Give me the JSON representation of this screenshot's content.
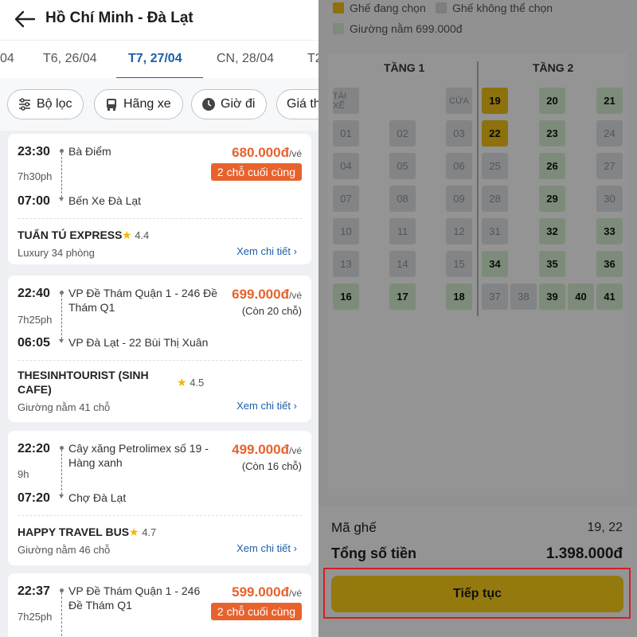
{
  "header": {
    "title": "Hồ Chí Minh - Đà Lạt",
    "back_icon": "arrow-left-icon"
  },
  "date_tabs": [
    {
      "label": "04"
    },
    {
      "label": "T6, 26/04"
    },
    {
      "label": "T7, 27/04",
      "active": true
    },
    {
      "label": "CN, 28/04"
    },
    {
      "label": "T2"
    }
  ],
  "filters": [
    {
      "label": "Bộ lọc",
      "icon": "sliders-icon"
    },
    {
      "label": "Hãng xe",
      "icon": "bus-icon"
    },
    {
      "label": "Giờ đi",
      "icon": "clock-icon"
    },
    {
      "label": "Giá th"
    }
  ],
  "trips": [
    {
      "depart": "23:30",
      "duration": "7h30ph",
      "arrive": "07:00",
      "from": "Bà Điểm",
      "to": "Bến Xe Đà Lạt",
      "price": "680.000đ",
      "per": "/vé",
      "badge": "2 chỗ cuối cùng",
      "remain": "",
      "operator": "TUẤN TÚ EXPRESS",
      "rating": "4.4",
      "coach": "Luxury 34 phòng",
      "detail": "Xem chi tiết"
    },
    {
      "depart": "22:40",
      "duration": "7h25ph",
      "arrive": "06:05",
      "from_1": "VP Đề Thám Quận 1 - 246 Đề",
      "from_2": "Thám Q1",
      "to": "VP Đà Lạt - 22 Bùi Thị Xuân",
      "price": "699.000đ",
      "per": "/vé",
      "badge": "",
      "remain": "(Còn 20 chỗ)",
      "operator_1": "THESINHTOURIST (SINH",
      "operator_2": "CAFE)",
      "rating": "4.5",
      "coach": "Giường nằm 41 chỗ",
      "detail": "Xem chi tiết"
    },
    {
      "depart": "22:20",
      "duration": "9h",
      "arrive": "07:20",
      "from_1": "Cây xăng Petrolimex số 19 -",
      "from_2": "Hàng xanh",
      "to": "Chợ Đà Lạt",
      "price": "499.000đ",
      "per": "/vé",
      "badge": "",
      "remain": "(Còn 16 chỗ)",
      "operator": "HAPPY TRAVEL BUS",
      "rating": "4.7",
      "coach": "Giường nằm 46 chỗ",
      "detail": "Xem chi tiết"
    },
    {
      "depart": "22:37",
      "duration": "7h25ph",
      "arrive": "",
      "from_1": "VP Đề Thám Quận 1 - 246",
      "from_2": "Đề Thám Q1",
      "to": "",
      "price": "599.000đ",
      "per": "/vé",
      "badge": "2 chỗ cuối cùng",
      "remain": ""
    }
  ],
  "legend": {
    "selected": "Ghế đang chọn",
    "unavailable": "Ghế không thể chọn",
    "sleeper": "Giường nằm 699.000đ"
  },
  "seatmap": {
    "floor1": "TẦNG 1",
    "floor2": "TẦNG 2",
    "driver": "TÀI XẾ",
    "door": "CỬA",
    "floor1_seats": [
      "01",
      "02",
      "03",
      "04",
      "05",
      "06",
      "07",
      "08",
      "09",
      "10",
      "11",
      "12",
      "13",
      "14",
      "15",
      "16",
      "17",
      "18"
    ],
    "floor2_seats": [
      "19",
      "20",
      "21",
      "22",
      "23",
      "24",
      "25",
      "26",
      "27",
      "28",
      "29",
      "30",
      "31",
      "32",
      "33",
      "34",
      "35",
      "36",
      "37",
      "38",
      "39",
      "40",
      "41"
    ],
    "selected": [
      "19",
      "22"
    ],
    "available": [
      "16",
      "17",
      "18",
      "20",
      "21",
      "23",
      "26",
      "29",
      "32",
      "33",
      "34",
      "35",
      "36",
      "39",
      "40",
      "41"
    ]
  },
  "summary": {
    "seat_label": "Mã ghế",
    "seat_value": "19, 22",
    "total_label": "Tổng số tiền",
    "total_value": "1.398.000đ",
    "continue": "Tiếp tục"
  },
  "colors": {
    "accent_blue": "#1d5fa8",
    "price_orange": "#e8622d",
    "selected_seat": "#f2c315",
    "available_seat": "#d8f2d2",
    "cta_yellow": "#ffd319",
    "highlight_red": "#d21f26"
  }
}
